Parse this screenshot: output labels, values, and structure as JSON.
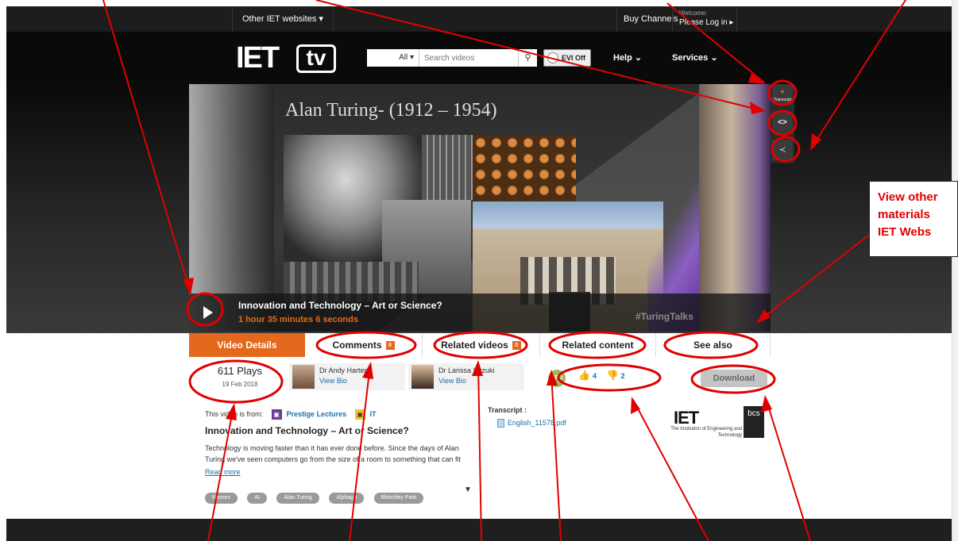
{
  "topbar": {
    "other_sites": "Other IET websites",
    "buy_channels": "Buy Channels",
    "welcome": "Welcome:",
    "login": "Please Log in ▸"
  },
  "header": {
    "logo_iet": "IET",
    "logo_tv": "tv",
    "search_scope": "All",
    "search_placeholder": "Search videos",
    "search_icon": "search-icon",
    "evi_label": "EVI Off",
    "nav_help": "Help",
    "nav_services": "Services"
  },
  "player": {
    "slide_title": "Alan Turing- (1912 – 1954)",
    "video_title": "Innovation and Technology – Art or Science?",
    "duration": "1 hour 35 minutes 6 seconds",
    "hashtag": "#TuringTalks",
    "side_transcript_plus": "+",
    "side_transcript_label": "Transcript",
    "side_embed": "<>",
    "side_share_icon": "share-icon"
  },
  "tabs": [
    {
      "label": "Video Details",
      "badge": ""
    },
    {
      "label": "Comments",
      "badge": "0"
    },
    {
      "label": "Related videos",
      "badge": "0"
    },
    {
      "label": "Related content",
      "badge": ""
    },
    {
      "label": "See also",
      "badge": ""
    }
  ],
  "details": {
    "plays": "611 Plays",
    "date": "19 Feb 2018",
    "speakers": [
      {
        "name": "Dr Andy Harter",
        "bio_link": "View Bio"
      },
      {
        "name": "Dr Larissa Suzuki",
        "bio_link": "View Bio"
      }
    ],
    "cpd": "CPD",
    "likes": "4",
    "dislikes": "2",
    "download": "Download"
  },
  "content": {
    "from_label": "This video is from:",
    "collection": "Prestige Lectures",
    "channel": "IT",
    "heading": "Innovation and Technology – Art or Science?",
    "description": "Technology is moving faster than it has ever done before. Since the days of Alan Turing we've seen computers go from the size of a room to something that can fit easily in our pockets.",
    "read_more": "Read more",
    "tags": [
      "Memex",
      "AI",
      "Alan Turing",
      "Alphago",
      "Bletchley Park"
    ],
    "transcript_label": "Transcript :",
    "transcript_file": "English_11578.pdf",
    "iet_mark": "IET",
    "iet_text": "The Institution of Engineering and Technology",
    "bcs_text": "bcs"
  },
  "annotation": {
    "callout": "View other materials IET Webs",
    "line_color": "#e00000"
  }
}
